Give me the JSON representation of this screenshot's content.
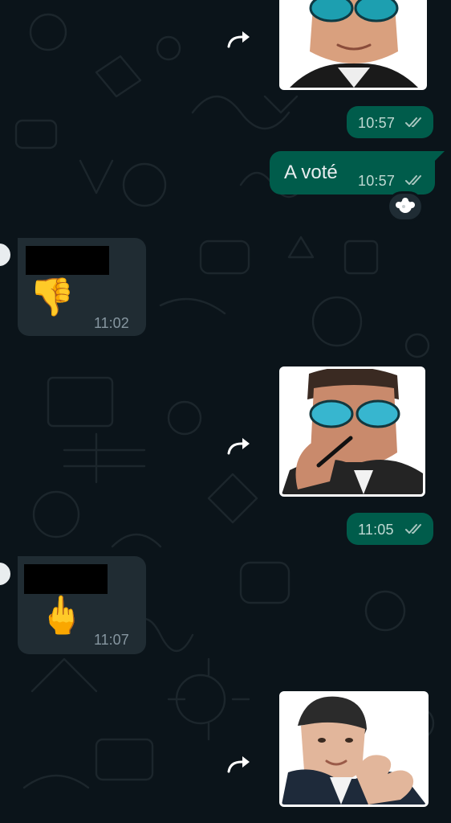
{
  "messages": [
    {
      "id": "sticker-1",
      "direction": "outgoing",
      "type": "sticker",
      "time": "10:57",
      "status": "read"
    },
    {
      "id": "text-1",
      "direction": "outgoing",
      "type": "text",
      "text": "A voté",
      "time": "10:57",
      "status": "read",
      "reaction_icon": "sparkle-ball-icon"
    },
    {
      "id": "in-1",
      "direction": "incoming",
      "type": "emoji",
      "sender_name_redacted": true,
      "emoji": "👎",
      "time": "11:02"
    },
    {
      "id": "sticker-2",
      "direction": "outgoing",
      "type": "sticker",
      "time": "11:05",
      "status": "read"
    },
    {
      "id": "in-2",
      "direction": "incoming",
      "type": "emoji",
      "sender_name_redacted": true,
      "emoji": "🖕",
      "time": "11:07"
    },
    {
      "id": "sticker-3",
      "direction": "outgoing",
      "type": "sticker"
    }
  ],
  "colors": {
    "background": "#0b141a",
    "outgoing_bubble": "#005c4b",
    "incoming_bubble": "#202c33",
    "read_ticks": "#a9c7c0"
  },
  "icons": {
    "forward": "forward-arrow-icon",
    "read_receipt": "double-check-icon"
  }
}
